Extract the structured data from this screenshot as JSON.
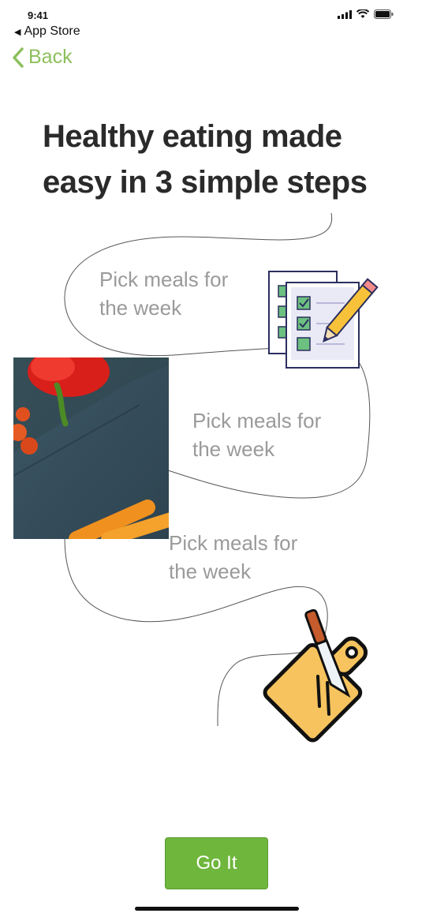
{
  "status_bar": {
    "time": "9:41"
  },
  "nav": {
    "app_store_label": "App Store",
    "back_label": "Back"
  },
  "header": {
    "title": "Healthy eating made easy in 3 simple steps"
  },
  "steps": [
    {
      "label": "Pick meals for the week",
      "icon": "clipboard-checklist-icon"
    },
    {
      "label": "Pick meals for the week",
      "icon": "vegetables-photo"
    },
    {
      "label": "Pick meals for the week",
      "icon": "cutting-board-knife-icon"
    }
  ],
  "cta": {
    "label": "Go It"
  },
  "colors": {
    "accent": "#6fb63c",
    "back": "#8cbf5c",
    "step_text": "#9a9a9a"
  }
}
